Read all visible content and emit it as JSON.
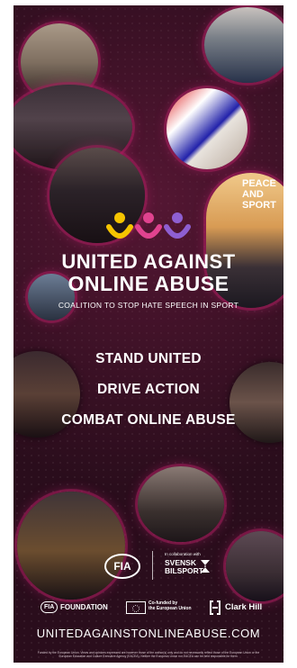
{
  "colors": {
    "background": "#2a0d1c",
    "glow": "#c2185b",
    "yellow": "#f5c400",
    "pink": "#e0438f",
    "purple": "#8e5fd1"
  },
  "logo": {
    "line1": "UNITED AGAINST",
    "line2": "ONLINE ABUSE",
    "subtitle": "COALITION TO STOP HATE SPEECH IN SPORT"
  },
  "slogans": [
    "STAND UNITED",
    "DRIVE ACTION",
    "COMBAT ONLINE ABUSE"
  ],
  "partners": {
    "fia": "FIA",
    "collab_text": "In collaboration with",
    "svensk_line1": "SVENSK",
    "svensk_line2": "BILSPORT",
    "fia_foundation": "FOUNDATION",
    "fia_foundation_mark": "FIA",
    "eu_line1": "Co-funded by",
    "eu_line2": "the European Union",
    "clark_hill": "Clark Hill"
  },
  "photo_text": {
    "peace_sport": "PEACE AND SPORT"
  },
  "url": "UNITEDAGAINSTONLINEABUSE.COM",
  "disclaimer": "Funded by the European Union. Views and opinions expressed are however those of the author(s) only and do not necessarily reflect those of the European Union or the European Education and Culture Executive Agency (EACEA). Neither the European Union nor EACEA can be held responsible for them."
}
